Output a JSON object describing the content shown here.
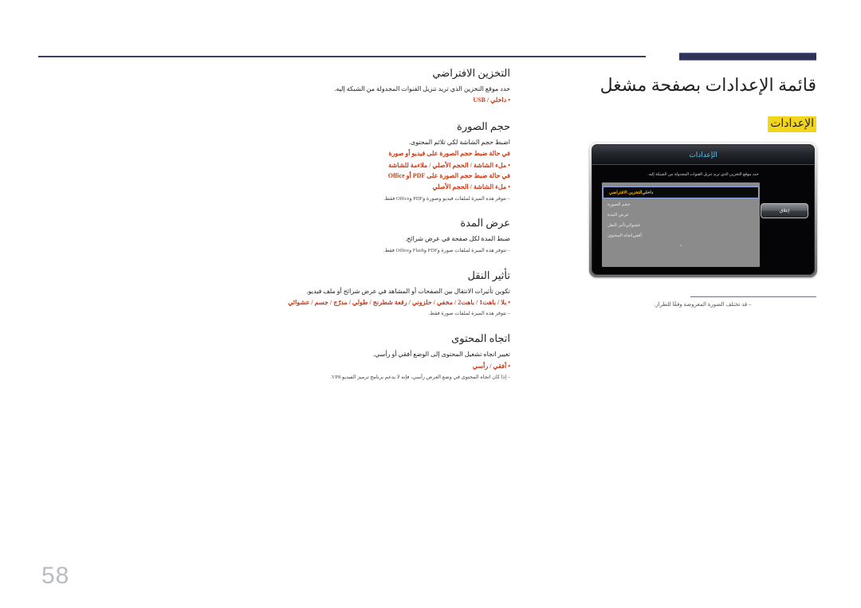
{
  "page": {
    "number": "58"
  },
  "header": {
    "title": "قائمة الإعدادات بصفحة مشغل",
    "section_chip": "الإعدادات"
  },
  "device": {
    "title": "الإعدادات",
    "description": "حدد موقع التخزين الذي تريد تنزيل القنوات المجدولة من الشبكة إليه.",
    "close_label": "إغلاق",
    "chevron": "⌄",
    "rows": [
      {
        "label": "التخزين الافتراضي",
        "value": "داخلي",
        "selected": true
      },
      {
        "label": "حجم الصورة",
        "value": "",
        "selected": false
      },
      {
        "label": "عرض المدة",
        "value": "",
        "selected": false
      },
      {
        "label": "تأثير النقل",
        "value": "عشوائي",
        "selected": false
      },
      {
        "label": "اتجاه المحتوى",
        "value": "أفقي",
        "selected": false
      }
    ],
    "note": "‒ قد تختلف الصورة المعروضة وفقًا للطراز."
  },
  "settings": [
    {
      "heading": "التخزين الافتراضي",
      "description": "حدد موقع التخزين الذي تريد تنزيل القنوات المجدولة من الشبكة إليه.",
      "values": "• داخلي / USB",
      "notes": []
    },
    {
      "heading": "حجم الصورة",
      "description": "اضبط حجم الشاشة لكي تلائم المحتوى.",
      "sub_conditions": [
        {
          "text": "في حالة ضبط حجم الصورة على فيديو أو صورة",
          "values": "• ملء الشاشة / الحجم الأصلي / ملاءمة للشاشة"
        },
        {
          "text": "في حالة ضبط حجم الصورة على PDF أو Office",
          "values": "• ملء الشاشة / الحجم الأصلي"
        }
      ],
      "notes": [
        "‒ تتوفر هذه الميزة لملفات فيديو وصورة وPDF وOffice فقط."
      ]
    },
    {
      "heading": "عرض المدة",
      "description": "ضبط المدة لكل صفحة في عرض شرائح.",
      "values": "",
      "notes": [
        "‒ تتوفر هذه الميزة لملفات صورة وPDF وFlash وOffice فقط."
      ]
    },
    {
      "heading": "تأثير النقل",
      "description": "تكوين تأثيرات الانتقال بين الصفحات أو المشاهد في عرض شرائح أو ملف فيديو.",
      "values": "• بلا / باهت1 / باهت2 / مخفي / حلزوني / رقعة شطرنج / طولي / مدرّج / جسم / عشوائي",
      "notes": [
        "‒ تتوفر هذه الميزة لملفات صورة فقط."
      ]
    },
    {
      "heading": "اتجاه المحتوى",
      "description": "تغيير اتجاه تشغيل المحتوى إلى الوضع أفقي أو رأسي.",
      "values": "• أفقي / رأسي",
      "notes": [
        "‒ إذا كان اتجاه المحتوى في وضع العرض رأسي، فإنه لا يدعم برنامج ترميز الفيديو VP8."
      ]
    }
  ]
}
